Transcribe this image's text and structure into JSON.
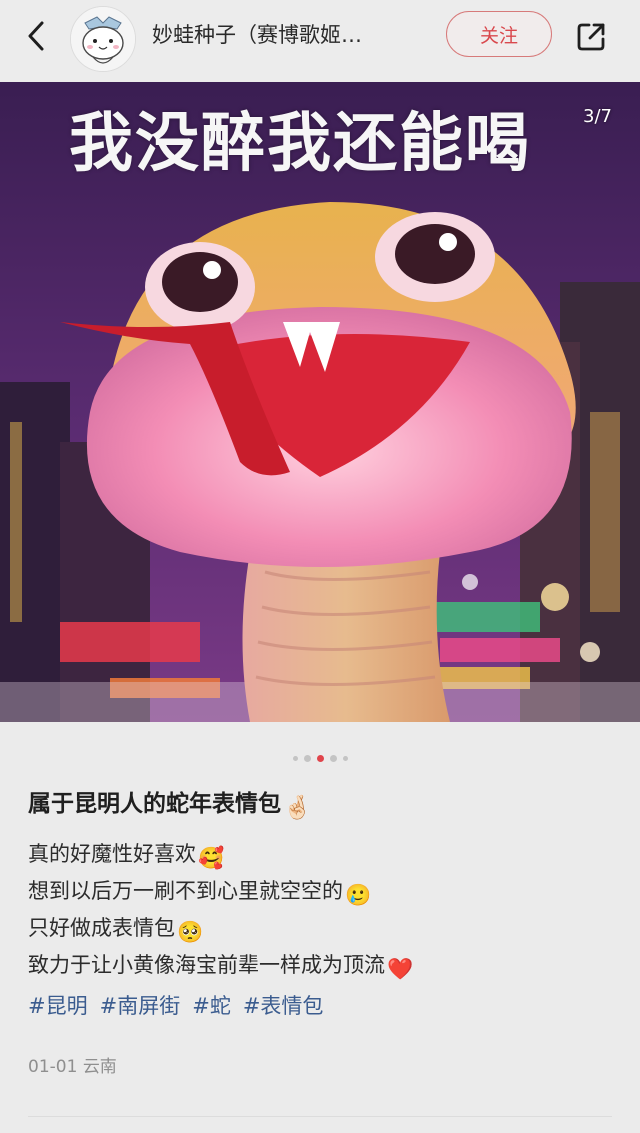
{
  "header": {
    "author_name": "妙蛙种子（赛博歌姬…",
    "follow_label": "关注",
    "back_icon": "chevron-left-icon",
    "share_icon": "share-external-icon"
  },
  "media": {
    "caption": "我没醉我还能喝",
    "page_counter": "3/7",
    "carousel_total_dots": 5,
    "carousel_active_index": 2
  },
  "post": {
    "title": "属于昆明人的蛇年表情包",
    "title_emoji": "🤞🏻",
    "lines": [
      {
        "text": "真的好魔性好喜欢",
        "emoji": "🥰"
      },
      {
        "text": "想到以后万一刷不到心里就空空的",
        "emoji": "🥲"
      },
      {
        "text": "只好做成表情包",
        "emoji": "🥺"
      },
      {
        "text": "致力于让小黄像海宝前辈一样成为顶流",
        "emoji": "❤️"
      }
    ],
    "hashtags": [
      "#昆明",
      "#南屏街",
      "#蛇",
      "#表情包"
    ],
    "date": "01-01",
    "location": "云南"
  },
  "colors": {
    "accent_red": "#d9484d",
    "hashtag_blue": "#3b5c8f",
    "background": "#ebebeb"
  }
}
